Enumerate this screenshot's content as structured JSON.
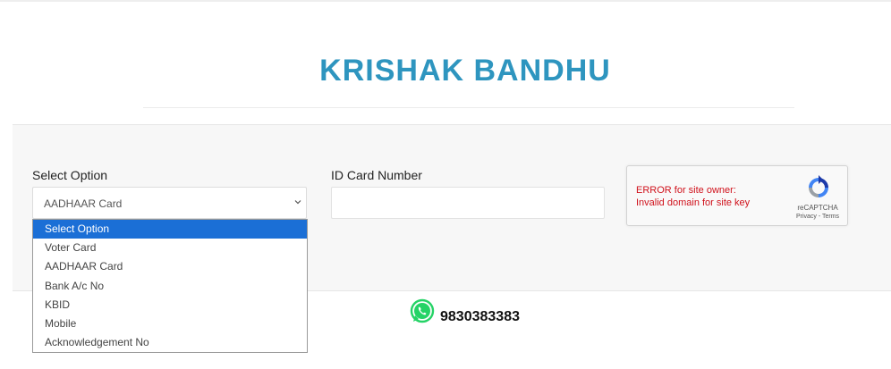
{
  "header": {
    "title": "KRISHAK BANDHU"
  },
  "form": {
    "select_label": "Select Option",
    "select_value": "AADHAAR Card",
    "id_label": "ID Card Number",
    "id_value": "",
    "dropdown_options": [
      "Select Option",
      "Voter Card",
      "AADHAAR Card",
      "Bank A/c No",
      "KBID",
      "Mobile",
      "Acknowledgement No"
    ],
    "highlighted_option": "Select Option"
  },
  "recaptcha": {
    "error_line1": "ERROR for site owner:",
    "error_line2": "Invalid domain for site key",
    "brand": "reCAPTCHA",
    "links": "Privacy - Terms",
    "icon": "recaptcha-logo-icon"
  },
  "contact": {
    "icon": "whatsapp-icon",
    "phone": "9830383383"
  },
  "colors": {
    "title": "#2e95bf",
    "highlight": "#1b6fd6",
    "error": "#d0111b",
    "whatsapp": "#25d366"
  }
}
